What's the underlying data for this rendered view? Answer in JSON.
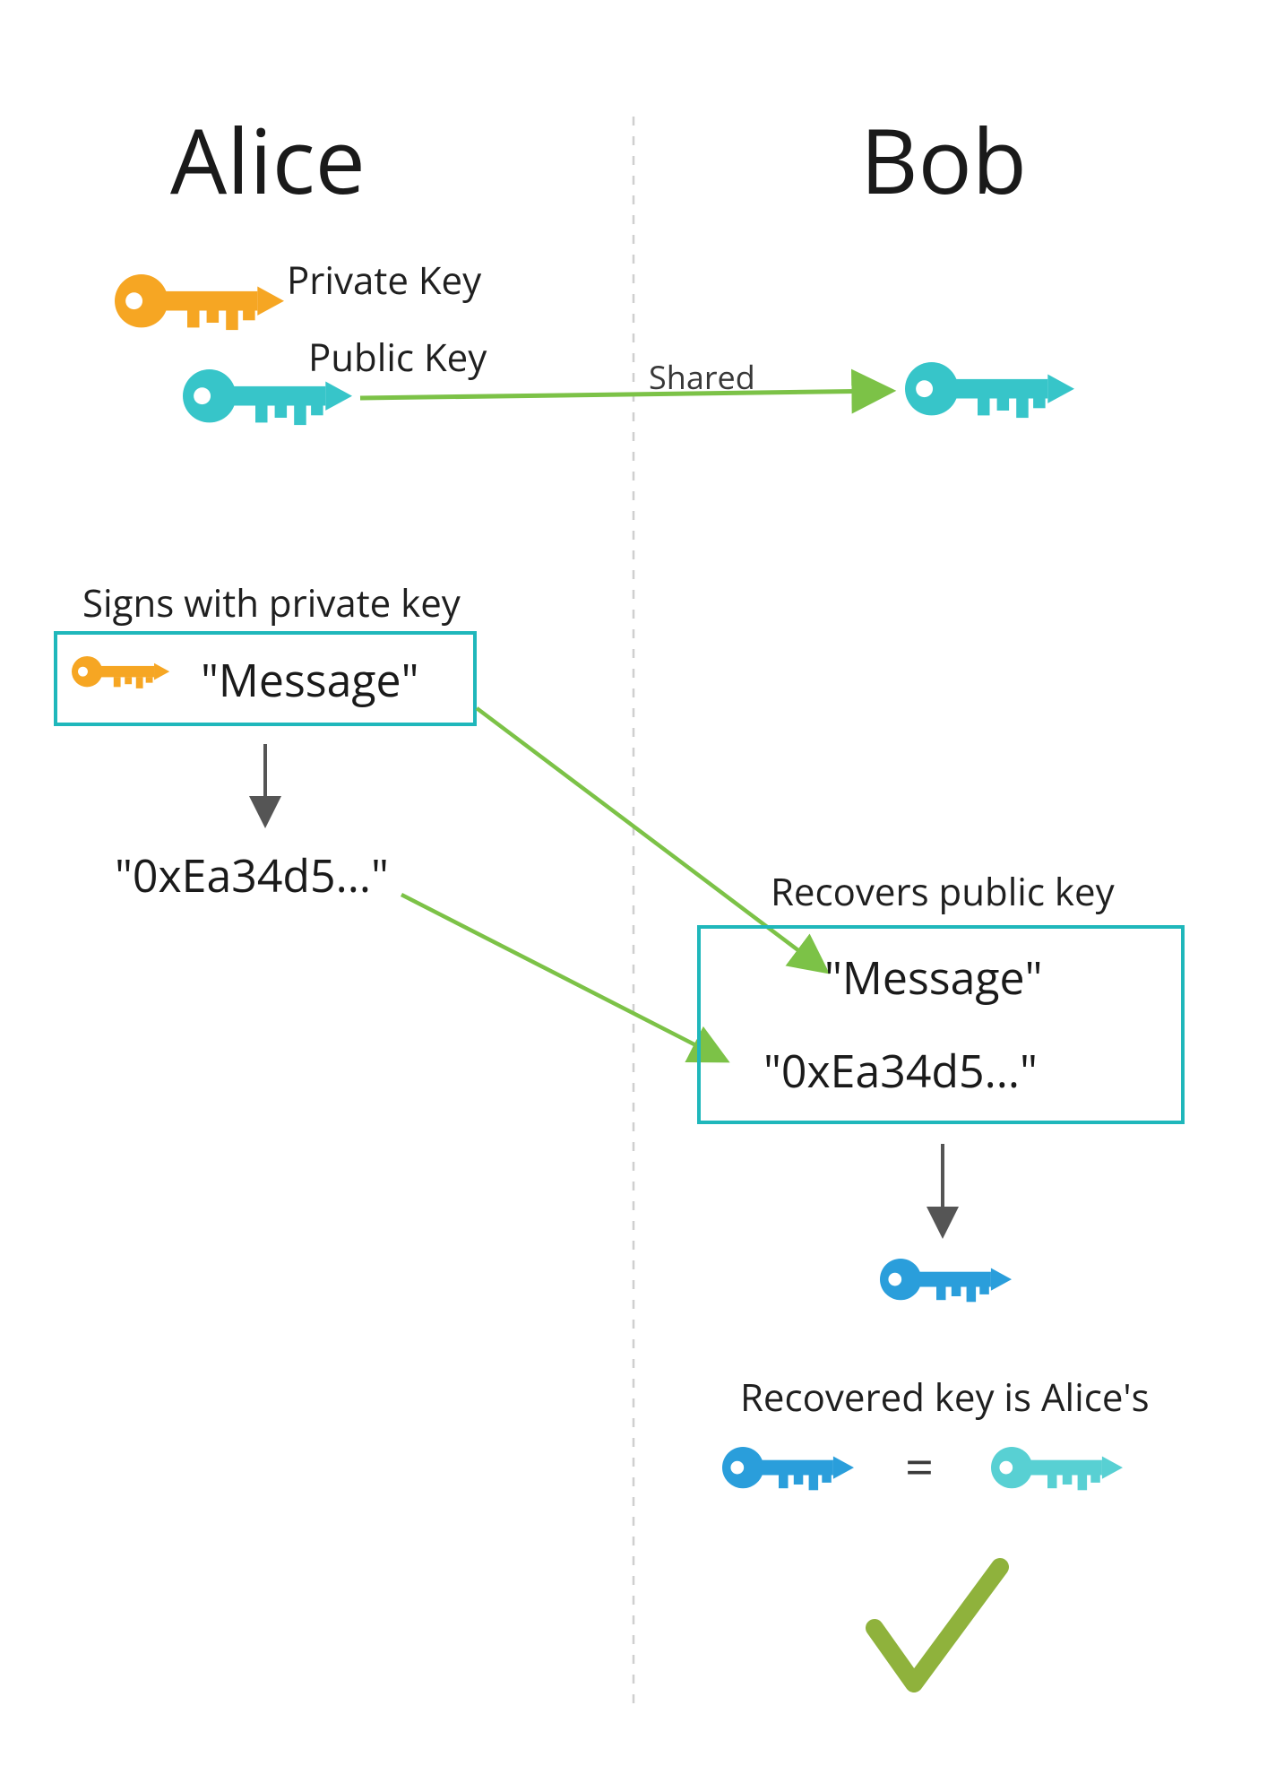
{
  "titles": {
    "alice": "Alice",
    "bob": "Bob"
  },
  "keys": {
    "private": "Private Key",
    "public": "Public Key"
  },
  "shared_label": "Shared",
  "sign_label": "Signs with private key",
  "message": "\"Message\"",
  "signature": "\"0xEa34d5...\"",
  "recover_label": "Recovers public key",
  "recovered_label": "Recovered key is Alice's",
  "equals": "=",
  "colors": {
    "orange": "#f6a623",
    "teal": "#37c5c9",
    "blue": "#2a9edb",
    "green": "#7cc247",
    "gray": "#555555",
    "dash": "#cfcfcf",
    "box": "#1fb7bb",
    "check": "#8fb23c"
  }
}
